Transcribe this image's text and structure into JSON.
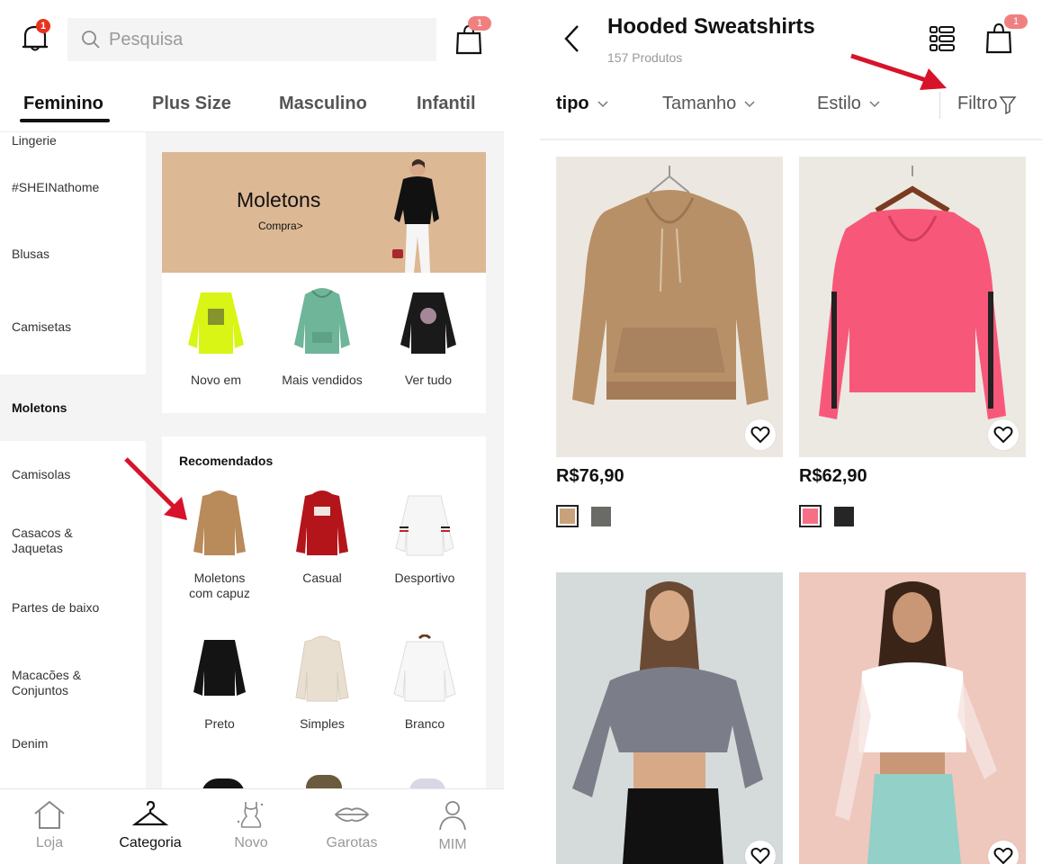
{
  "left_screen": {
    "header": {
      "notification_count": "1",
      "search_placeholder": "Pesquisa",
      "cart_count": "1"
    },
    "tabs": [
      {
        "label": "Feminino",
        "active": true
      },
      {
        "label": "Plus Size",
        "active": false
      },
      {
        "label": "Masculino",
        "active": false
      },
      {
        "label": "Infantil",
        "active": false
      }
    ],
    "sidebar": {
      "items": [
        {
          "label": "Lingerie"
        },
        {
          "label": "#SHEINathome"
        },
        {
          "label": "Blusas"
        },
        {
          "label": "Camisetas"
        },
        {
          "label": "Moletons",
          "active": true
        },
        {
          "label": "Camisolas"
        },
        {
          "label": "Casacos & Jaquetas"
        },
        {
          "label": "Partes de baixo"
        },
        {
          "label": "Macacões & Conjuntos"
        },
        {
          "label": "Denim"
        }
      ]
    },
    "banner": {
      "title": "Moletons",
      "cta": "Compra>",
      "background_color": "#dcb894"
    },
    "quick_links": [
      {
        "label": "Novo em",
        "garment_color": "#d8f516"
      },
      {
        "label": "Mais vendidos",
        "garment_color": "#6fb59a"
      },
      {
        "label": "Ver tudo",
        "garment_color": "#1a1a1a"
      }
    ],
    "recommended": {
      "title": "Recomendados",
      "items": [
        {
          "label": "Moletons com capuz",
          "garment_color": "#b98a5a"
        },
        {
          "label": "Casual",
          "garment_color": "#b3151b"
        },
        {
          "label": "Desportivo",
          "garment_color": "#f6f6f6"
        },
        {
          "label": "Preto",
          "garment_color": "#141414"
        },
        {
          "label": "Simples",
          "garment_color": "#e9dfd1"
        },
        {
          "label": "Branco",
          "garment_color": "#f7f7f7"
        }
      ]
    },
    "bottom_nav": [
      {
        "label": "Loja",
        "icon": "home-icon",
        "active": false
      },
      {
        "label": "Categoria",
        "icon": "hanger-icon",
        "active": true
      },
      {
        "label": "Novo",
        "icon": "dress-icon",
        "active": false
      },
      {
        "label": "Garotas",
        "icon": "lips-icon",
        "active": false
      },
      {
        "label": "MIM",
        "icon": "user-icon",
        "active": false
      }
    ]
  },
  "right_screen": {
    "header": {
      "title": "Hooded Sweatshirts",
      "product_count": "157 Produtos",
      "cart_count": "1"
    },
    "filters": [
      {
        "label": "tipo",
        "has_dropdown": true
      },
      {
        "label": "Tamanho",
        "has_dropdown": true
      },
      {
        "label": "Estilo",
        "has_dropdown": true
      },
      {
        "label": "Filtro",
        "icon": "funnel-icon"
      }
    ],
    "products": [
      {
        "price": "R$76,90",
        "image_bg": "#ece8e1",
        "garment_color": "#b89068",
        "swatches": [
          "#c9a27b",
          "#6a6a66"
        ],
        "selected_swatch": 0
      },
      {
        "price": "R$62,90",
        "image_bg": "#ebe9e1",
        "garment_color": "#f7587a",
        "swatches": [
          "#f76f84",
          "#262626"
        ],
        "selected_swatch": 0
      },
      {
        "image_bg": "#d5dadb",
        "garment_color": "#7b7d88"
      },
      {
        "image_bg": "#eec7bd",
        "garment_color": "#ffffff"
      }
    ]
  },
  "annotation_color": "#d7132a"
}
